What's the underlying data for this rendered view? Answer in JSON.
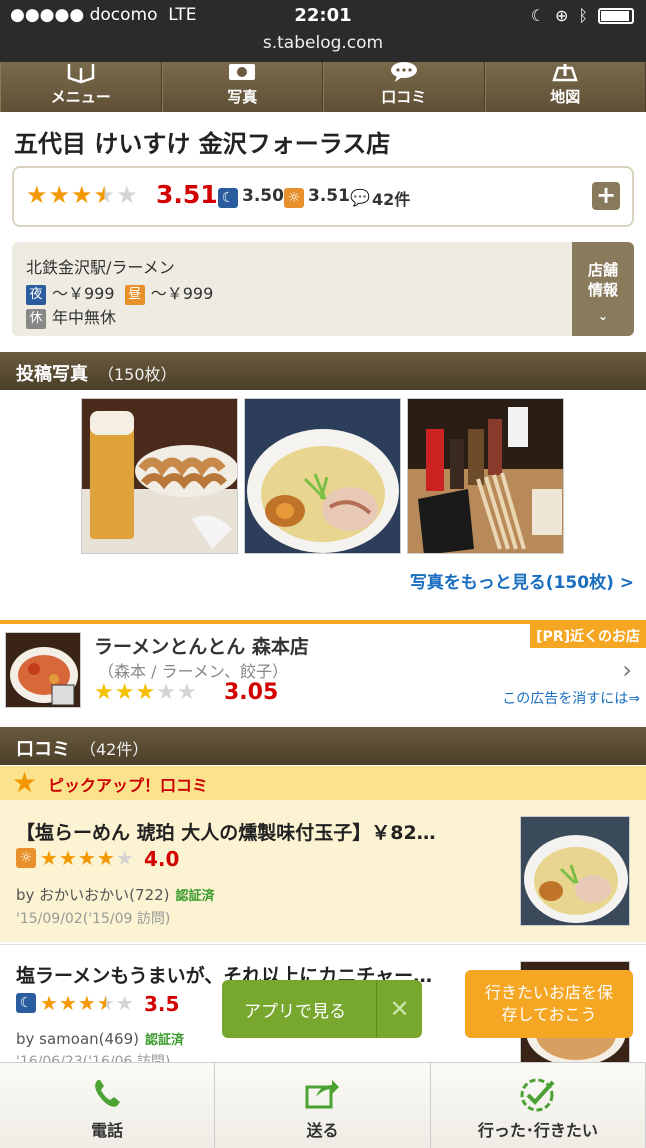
{
  "status": {
    "carrier": "●●●●● docomo",
    "network": "LTE",
    "time": "22:01",
    "url": "s.tabelog.com"
  },
  "topnav": [
    {
      "label": "メニュー",
      "icon": "book-icon"
    },
    {
      "label": "写真",
      "icon": "camera-icon"
    },
    {
      "label": "口コミ",
      "icon": "speech-bubble-icon"
    },
    {
      "label": "地図",
      "icon": "map-icon"
    }
  ],
  "shop": {
    "name": "五代目 けいすけ 金沢フォーラス店",
    "rating": "3.51",
    "rating_value": 3.5,
    "night_rating": "3.50",
    "day_rating": "3.51",
    "reviews": "42件",
    "access": "北鉄金沢駅/ラーメン",
    "night_tag": "夜",
    "night_price": "～￥999",
    "day_tag": "昼",
    "day_price": "～￥999",
    "holiday_tag": "休",
    "holiday": "年中無休",
    "info_button": "店舗\n情報"
  },
  "photos_section": {
    "title": "投稿写真",
    "count": "（150枚）",
    "more": "写真をもっと見る(150枚) >"
  },
  "ad": {
    "pr": "[PR]近くのお店",
    "name": "ラーメンとんとん 森本店",
    "sub": "（森本 / ラーメン、餃子）",
    "rating": "3.05",
    "rating_value": 3.0,
    "hide": "この広告を消すには⇒"
  },
  "reviews_section": {
    "title": "口コミ",
    "count": "（42件）",
    "pickup": "ピックアップ！口コミ"
  },
  "reviews": [
    {
      "title": "【塩らーめん 琥珀 大人の燻製味付玉子】￥82…",
      "score": "4.0",
      "score_value": 4.0,
      "time": "day",
      "by": "by おかいおかい(722)",
      "verified": "認証済",
      "date": "'15/09/02('15/09 訪問)"
    },
    {
      "title": "塩ラーメンもうまいが、それ以上にカニチャー…",
      "score": "3.5",
      "score_value": 3.5,
      "time": "night",
      "by": "by samoan(469)",
      "verified": "認証済",
      "date": "'16/06/23('16/06 訪問)"
    }
  ],
  "app_button": {
    "label": "アプリで見る",
    "close": "✕"
  },
  "save_button": {
    "label": "行きたいお店を保存しておこう"
  },
  "bottombar": [
    {
      "label": "電話",
      "icon": "phone-icon"
    },
    {
      "label": "送る",
      "icon": "share-icon"
    },
    {
      "label": "行った･行きたい",
      "icon": "check-icon"
    }
  ]
}
